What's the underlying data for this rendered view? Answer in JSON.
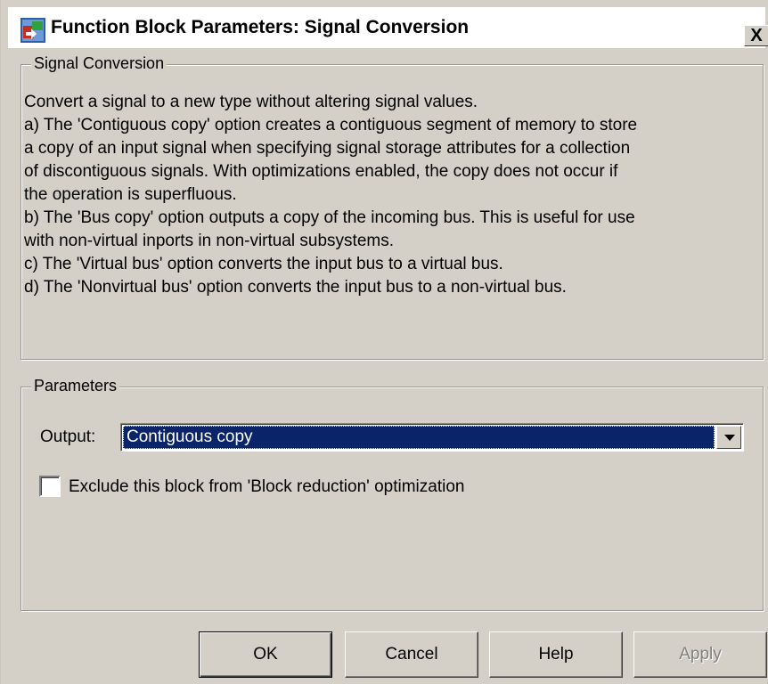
{
  "window": {
    "title": "Function Block Parameters: Signal Conversion",
    "close_label": "X"
  },
  "description_group": {
    "label": "Signal Conversion",
    "lines": [
      "Convert a signal to a new type without altering signal values.",
      "a) The 'Contiguous copy' option creates a contiguous segment of memory to store",
      "a copy of an input signal when specifying signal storage attributes for a collection",
      "of discontiguous signals.  With optimizations enabled, the copy does not occur if",
      "the operation is superfluous.",
      "b) The 'Bus copy' option outputs a copy of the incoming bus. This is useful for use",
      "with non-virtual inports in non-virtual subsystems.",
      "c) The 'Virtual bus' option converts the input bus to a virtual bus.",
      "d) The 'Nonvirtual bus' option converts the input bus to a non-virtual bus."
    ]
  },
  "parameters_group": {
    "label": "Parameters",
    "output_label": "Output:",
    "output_value": "Contiguous copy",
    "exclude_label": "Exclude this block from 'Block reduction' optimization",
    "exclude_checked": false
  },
  "buttons": {
    "ok": "OK",
    "cancel": "Cancel",
    "help": "Help",
    "apply": "Apply"
  },
  "colors": {
    "dialog_bg": "#d4d0c8",
    "selection_bg": "#0a246a",
    "disabled_text": "#808080"
  }
}
